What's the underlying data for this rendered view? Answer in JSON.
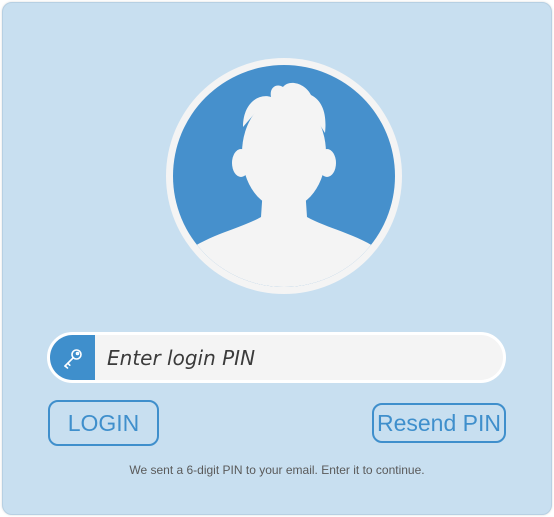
{
  "login": {
    "avatar_icon": "user-avatar-icon",
    "pin_icon": "key-icon",
    "pin_placeholder": "Enter login PIN",
    "login_label": "LOGIN",
    "resend_label": "Resend PIN",
    "hint_text": "We sent a 6-digit PIN to your email. Enter it to continue."
  },
  "colors": {
    "background": "#c8dff0",
    "accent": "#3f8fcc",
    "input_bg": "#f4f4f4",
    "avatar_fg": "#f4f4f4"
  }
}
